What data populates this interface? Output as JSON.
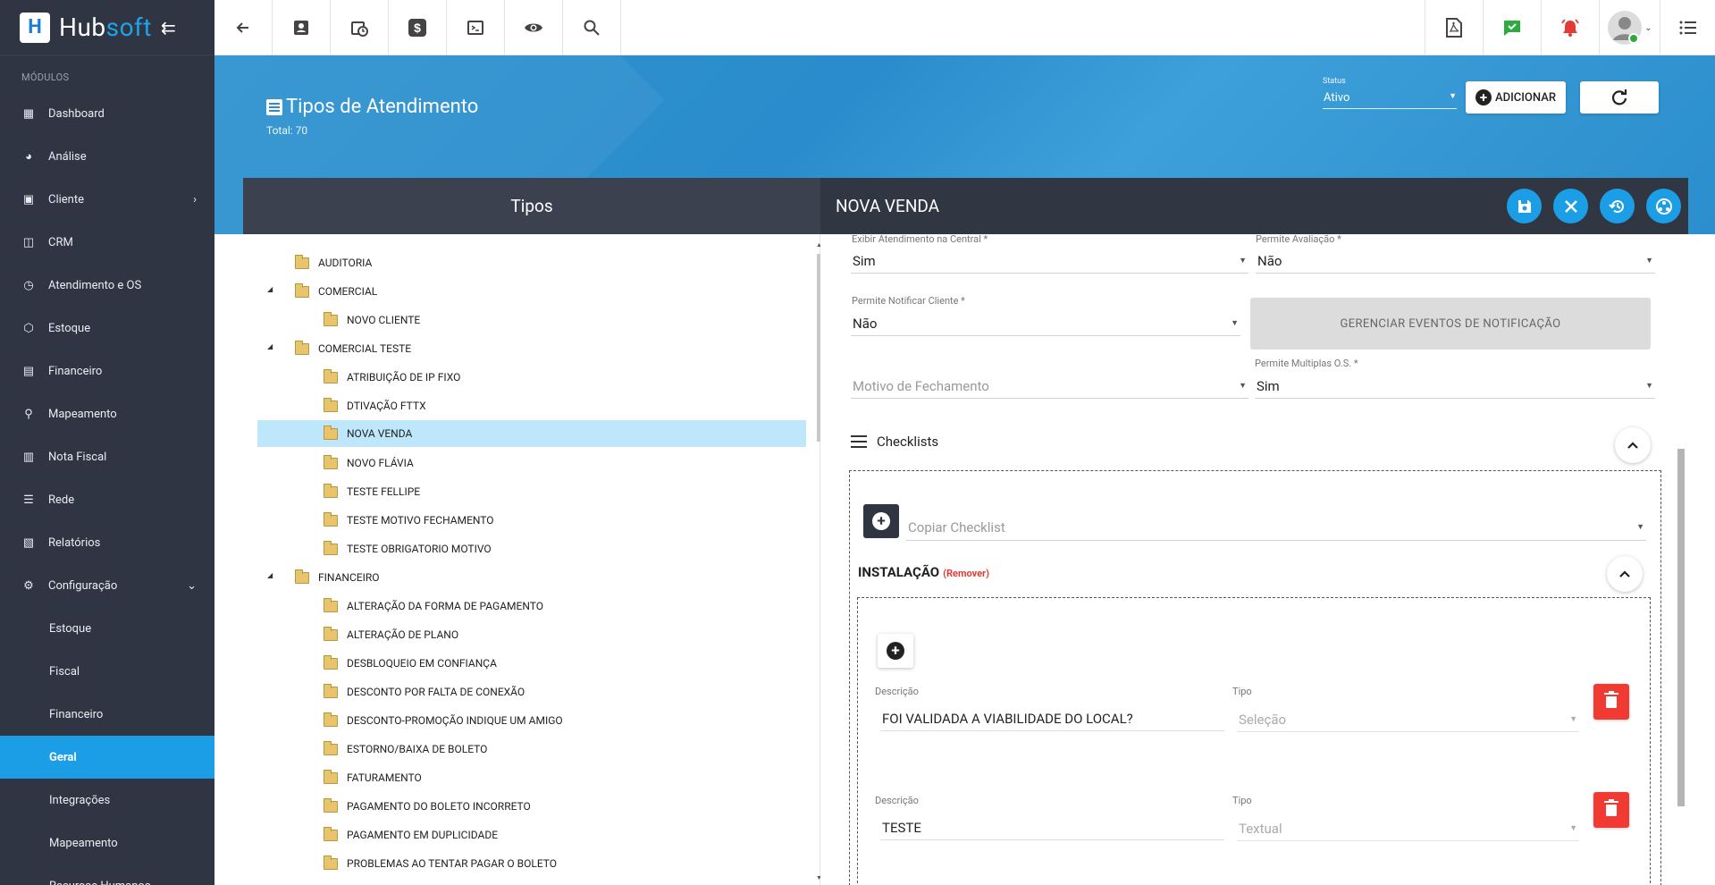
{
  "brand": {
    "name_a": "Hub",
    "name_b": "soft"
  },
  "sidebar": {
    "modules_title": "MÓDULOS",
    "items": [
      {
        "label": "Dashboard"
      },
      {
        "label": "Análise"
      },
      {
        "label": "Cliente"
      },
      {
        "label": "CRM"
      },
      {
        "label": "Atendimento e OS"
      },
      {
        "label": "Estoque"
      },
      {
        "label": "Financeiro"
      },
      {
        "label": "Mapeamento"
      },
      {
        "label": "Nota Fiscal"
      },
      {
        "label": "Rede"
      },
      {
        "label": "Relatórios"
      },
      {
        "label": "Configuração"
      }
    ],
    "sub_items": [
      {
        "label": "Estoque"
      },
      {
        "label": "Fiscal"
      },
      {
        "label": "Financeiro"
      },
      {
        "label": "Geral"
      },
      {
        "label": "Integrações"
      },
      {
        "label": "Mapeamento"
      },
      {
        "label": "Recursos Humanos"
      }
    ]
  },
  "header": {
    "title": "Tipos de Atendimento",
    "total": "Total: 70",
    "status_label": "Status",
    "status_value": "Ativo",
    "add_label": "ADICIONAR"
  },
  "left_panel": {
    "title": "Tipos",
    "tree": [
      {
        "label": "AUDITORIA"
      },
      {
        "label": "COMERCIAL"
      },
      {
        "label": "NOVO CLIENTE"
      },
      {
        "label": "COMERCIAL TESTE"
      },
      {
        "label": "ATRIBUIÇÃO DE IP FIXO"
      },
      {
        "label": "DTIVAÇÃO FTTX"
      },
      {
        "label": "NOVA VENDA"
      },
      {
        "label": "NOVO FLÁVIA"
      },
      {
        "label": "TESTE FELLIPE"
      },
      {
        "label": "TESTE MOTIVO FECHAMENTO"
      },
      {
        "label": "TESTE OBRIGATORIO MOTIVO"
      },
      {
        "label": "FINANCEIRO"
      },
      {
        "label": "ALTERAÇÃO DA FORMA DE PAGAMENTO"
      },
      {
        "label": "ALTERAÇÃO DE PLANO"
      },
      {
        "label": "DESBLOQUEIO EM CONFIANÇA"
      },
      {
        "label": "DESCONTO POR FALTA DE CONEXÃO"
      },
      {
        "label": "DESCONTO-PROMOÇÃO INDIQUE UM AMIGO"
      },
      {
        "label": "ESTORNO/BAIXA DE BOLETO"
      },
      {
        "label": "FATURAMENTO"
      },
      {
        "label": "PAGAMENTO DO BOLETO INCORRETO"
      },
      {
        "label": "PAGAMENTO EM DUPLICIDADE"
      },
      {
        "label": "PROBLEMAS AO TENTAR PAGAR O BOLETO"
      }
    ]
  },
  "right_panel": {
    "title": "NOVA VENDA",
    "exibir_label": "Exibir Atendimento na Central *",
    "exibir_value": "Sim",
    "avaliacao_label": "Permite Avaliação *",
    "avaliacao_value": "Não",
    "notificar_label": "Permite Notificar Cliente *",
    "notificar_value": "Não",
    "gerenciar_label": "GERENCIAR EVENTOS DE NOTIFICAÇÃO",
    "motivo_placeholder": "Motivo de Fechamento",
    "multiplas_label": "Permite Multiplas O.S. *",
    "multiplas_value": "Sim",
    "checklists_title": "Checklists",
    "copiar_placeholder": "Copiar Checklist",
    "instalacao_title": "INSTALAÇÃO",
    "remover_label": "(Remover)",
    "items": [
      {
        "desc_label": "Descrição",
        "desc_value": "FOI VALIDADA A VIABILIDADE DO LOCAL?",
        "tipo_label": "Tipo",
        "tipo_value": "Seleção"
      },
      {
        "desc_label": "Descrição",
        "desc_value": "TESTE",
        "tipo_label": "Tipo",
        "tipo_value": "Textual"
      }
    ]
  },
  "colors": {
    "accent": "#1b9ee6",
    "sidebar": "#2f3542",
    "danger": "#f03a32",
    "alert": "#e53935",
    "success": "#2eaa3f"
  }
}
